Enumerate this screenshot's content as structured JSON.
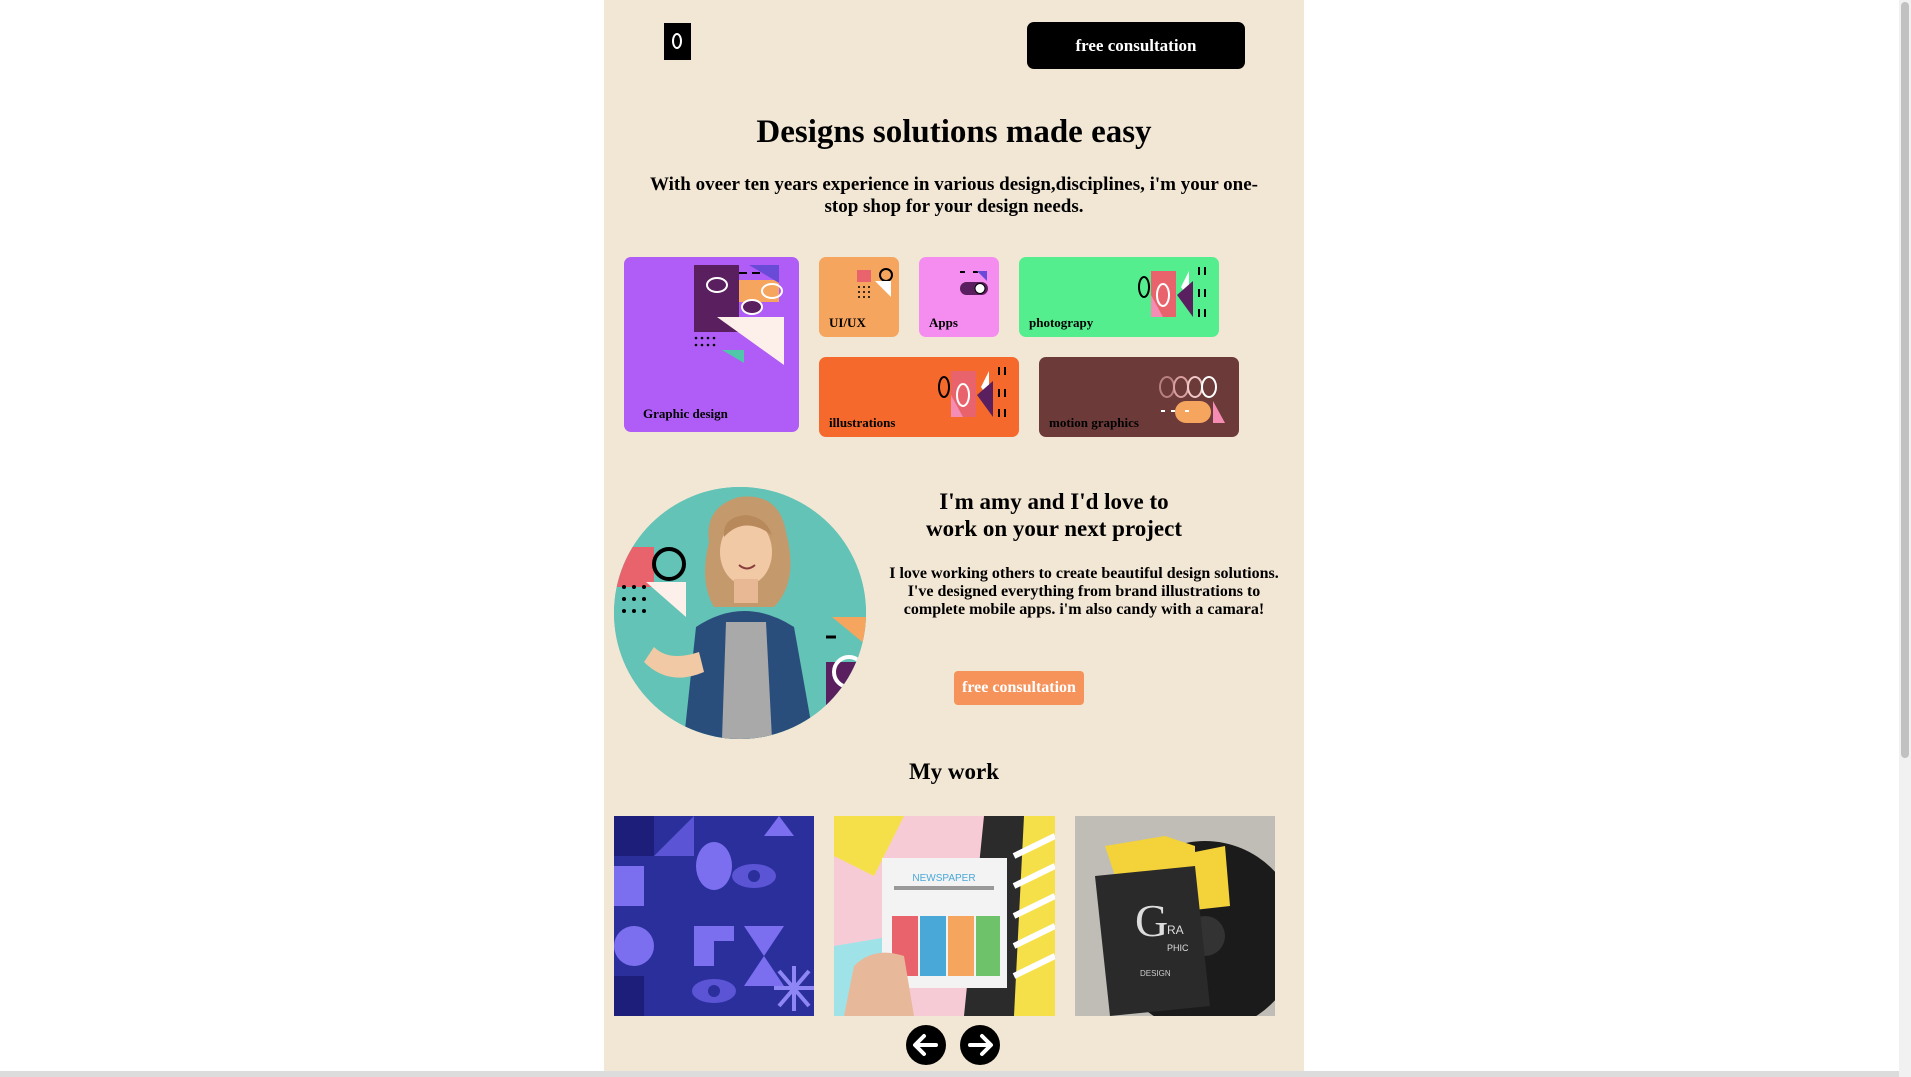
{
  "header": {
    "logo_icon": "logo-ring-icon",
    "cta_label": "free consultation"
  },
  "hero": {
    "title": "Designs solutions made easy",
    "subtitle": "With oveer ten years experience in various design,disciplines, i'm your one-stop shop for your design needs."
  },
  "services": {
    "cards": [
      {
        "label": "Graphic design",
        "color": "#b05cf6"
      },
      {
        "label": "UI/UX",
        "color": "#f5a55e"
      },
      {
        "label": "Apps",
        "color": "#f58cf0"
      },
      {
        "label": "photograpy",
        "color": "#55ee8f"
      },
      {
        "label": "illustrations",
        "color": "#f56a2c"
      },
      {
        "label": "motion graphics",
        "color": "#6d3a3a"
      }
    ]
  },
  "about": {
    "title_line1": "I'm amy and I'd love to",
    "title_line2": "work on your next project",
    "text": "I love working others to create beautiful design solutions. I've designed everything from brand illustrations to complete mobile apps. i'm also candy with a camara!",
    "cta_label": "free consultation",
    "accent_color": "#f5935b"
  },
  "work": {
    "title": "My work",
    "items": [
      {
        "name": "pattern-artwork"
      },
      {
        "name": "newspaper-artwork"
      },
      {
        "name": "graphic-book-artwork"
      }
    ],
    "prev_icon": "arrow-left-icon",
    "next_icon": "arrow-right-icon"
  },
  "colors": {
    "page_background": "#f2e6d4",
    "button_dark": "#000000"
  }
}
